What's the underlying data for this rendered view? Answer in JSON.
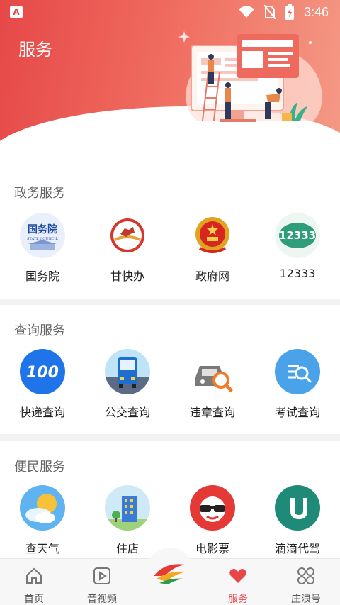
{
  "status": {
    "time": "3:46",
    "app_icon_letter": "A"
  },
  "header": {
    "title": "服务"
  },
  "sections": [
    {
      "title": "政务服务",
      "items": [
        {
          "label": "国务院",
          "icon": "state-council-icon",
          "icon_text": "国务院",
          "icon_subtext": "STATE COUNCIL"
        },
        {
          "label": "甘快办",
          "icon": "gan-kuai-ban-icon"
        },
        {
          "label": "政府网",
          "icon": "national-emblem-icon"
        },
        {
          "label": "12333",
          "icon": "12333-icon",
          "icon_text": "12333"
        }
      ]
    },
    {
      "title": "查询服务",
      "items": [
        {
          "label": "快递查询",
          "icon": "express-100-icon",
          "icon_text": "100"
        },
        {
          "label": "公交查询",
          "icon": "bus-icon"
        },
        {
          "label": "违章查询",
          "icon": "car-search-icon"
        },
        {
          "label": "考试查询",
          "icon": "exam-search-icon"
        }
      ]
    },
    {
      "title": "便民服务",
      "items": [
        {
          "label": "查天气",
          "icon": "weather-icon"
        },
        {
          "label": "住店",
          "icon": "hotel-icon"
        },
        {
          "label": "电影票",
          "icon": "movie-ticket-icon"
        },
        {
          "label": "滴滴代驾",
          "icon": "didi-icon"
        }
      ]
    }
  ],
  "bottom_nav": [
    {
      "label": "首页",
      "icon": "home-icon"
    },
    {
      "label": "音视频",
      "icon": "video-icon"
    },
    {
      "label": "服务",
      "icon": "heart-icon",
      "active": true
    },
    {
      "label": "庄浪号",
      "icon": "grid-icon"
    }
  ],
  "colors": {
    "accent": "#e64848",
    "header_gradient_end": "#f49a86"
  }
}
